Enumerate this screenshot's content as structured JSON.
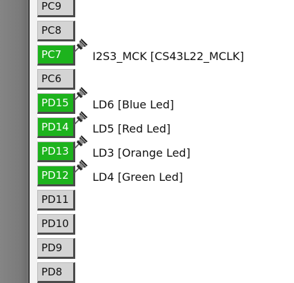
{
  "pins": [
    {
      "label": "PC9",
      "active": false
    },
    {
      "label": "PC8",
      "active": false
    },
    {
      "label": "PC7",
      "active": true,
      "signal": "I2S3_MCK [CS43L22_MCLK]"
    },
    {
      "label": "PC6",
      "active": false
    },
    {
      "label": "PD15",
      "active": true,
      "signal": "LD6 [Blue Led]"
    },
    {
      "label": "PD14",
      "active": true,
      "signal": "LD5 [Red Led]"
    },
    {
      "label": "PD13",
      "active": true,
      "signal": "LD3 [Orange Led]"
    },
    {
      "label": "PD12",
      "active": true,
      "signal": "LD4 [Green Led]"
    },
    {
      "label": "PD11",
      "active": false
    },
    {
      "label": "PD10",
      "active": false
    },
    {
      "label": "PD9",
      "active": false
    },
    {
      "label": "PD8",
      "active": false
    }
  ],
  "colors": {
    "active_pin": "#1db31d",
    "inactive_pin": "#d4d4d4"
  },
  "icons": {
    "pinned": "pushpin-icon"
  }
}
